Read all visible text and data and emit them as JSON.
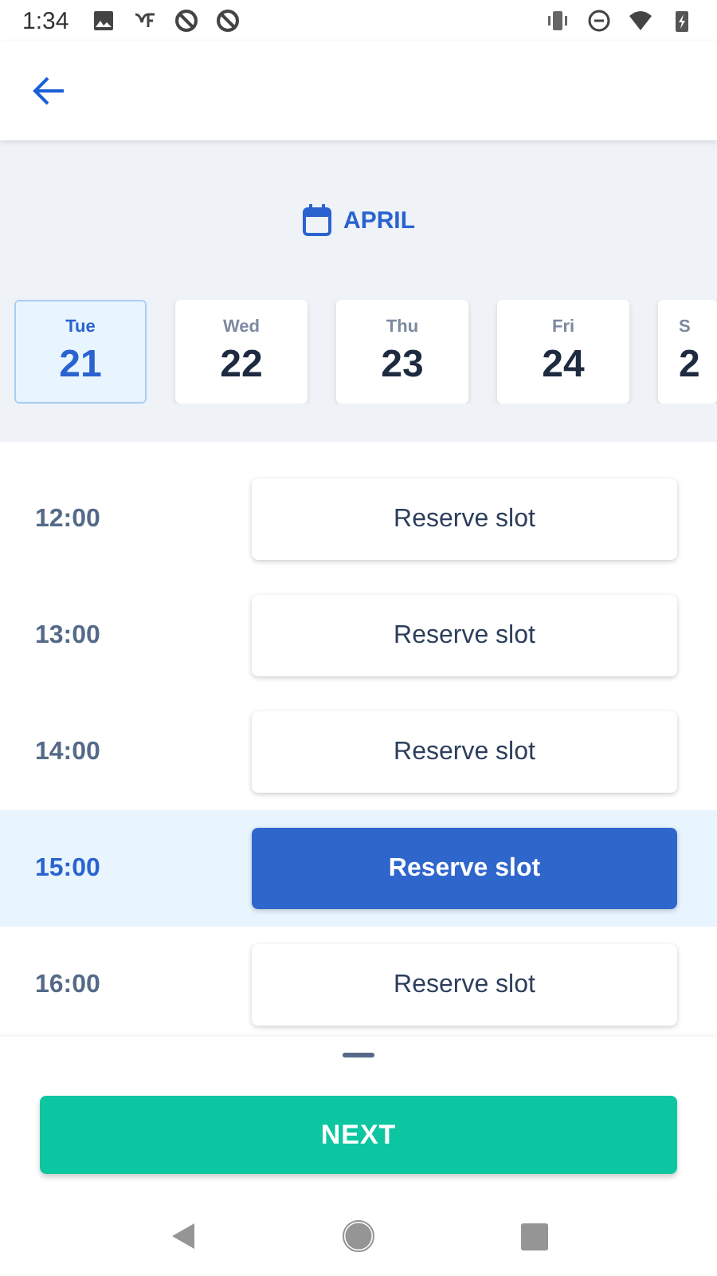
{
  "status_bar": {
    "time": "1:34"
  },
  "month": "APRIL",
  "days": [
    {
      "weekday": "Tue",
      "date": "21",
      "selected": true
    },
    {
      "weekday": "Wed",
      "date": "22",
      "selected": false
    },
    {
      "weekday": "Thu",
      "date": "23",
      "selected": false
    },
    {
      "weekday": "Fri",
      "date": "24",
      "selected": false
    },
    {
      "weekday": "S",
      "date": "2",
      "selected": false
    }
  ],
  "slots": [
    {
      "time": "12:00",
      "button": "Reserve slot",
      "selected": false
    },
    {
      "time": "13:00",
      "button": "Reserve slot",
      "selected": false
    },
    {
      "time": "14:00",
      "button": "Reserve slot",
      "selected": false
    },
    {
      "time": "15:00",
      "button": "Reserve slot",
      "selected": true
    },
    {
      "time": "16:00",
      "button": "Reserve slot",
      "selected": false
    }
  ],
  "next_button": "NEXT"
}
